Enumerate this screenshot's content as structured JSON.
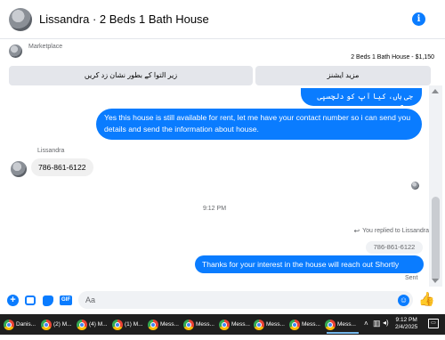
{
  "header": {
    "title": "Lissandra · 2 Beds 1 Bath House",
    "info_icon": "info-icon"
  },
  "marketplace": {
    "label": "Marketplace",
    "listing_line": "2 Beds 1 Bath House - $1,150",
    "btn_mark_unread": "زیر التوا کے بطور نشان زد کریں",
    "btn_more_actions": "مزید ایشنز"
  },
  "messages": {
    "out_urdu": "جی ہاں، کیا آپ کو دلچسپی ہے؟",
    "out_available": "Yes this house is still available for rent, let me have your contact number so i can send you details and send the information about house.",
    "sender_name": "Lissandra",
    "in_phone": "786-861-6122",
    "timestamp": "9:12 PM",
    "replied_to": "You replied to Lissandra",
    "quoted_text": "786-861-6122",
    "out_thanks": "Thanks for your interest in the house will reach out Shortly",
    "sent_status": "Sent"
  },
  "composer": {
    "placeholder": "Aa",
    "plus_icon": "+",
    "gif_label": "GIF",
    "emoji_icon": "☺",
    "like_icon": "👍"
  },
  "taskbar": {
    "items": [
      {
        "label": "Danis..."
      },
      {
        "label": "(2) M..."
      },
      {
        "label": "(4) M..."
      },
      {
        "label": "(1) M..."
      },
      {
        "label": "Mess..."
      },
      {
        "label": "Mess..."
      },
      {
        "label": "Mess..."
      },
      {
        "label": "Mess..."
      },
      {
        "label": "Mess..."
      },
      {
        "label": "Mess..."
      }
    ],
    "clock_time": "9:12 PM",
    "clock_date": "2/4/2025"
  },
  "colors": {
    "messenger_blue": "#0a7cff",
    "incoming_bubble": "#f0f0f0",
    "taskbar": "#1f1f1f"
  }
}
